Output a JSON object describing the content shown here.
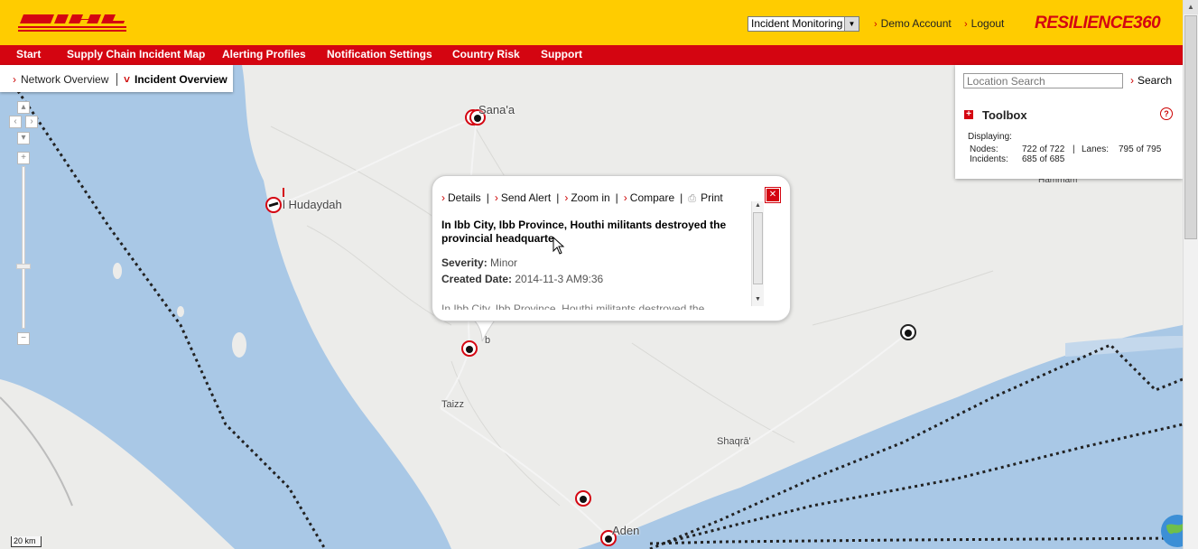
{
  "header": {
    "logo_text": "DHL",
    "mode_select": "Incident Monitoring",
    "account_link": "Demo Account",
    "logout_link": "Logout",
    "brand": "RESILIENCE360",
    "colors": {
      "brand_red": "#d40511",
      "brand_yellow": "#ffcc00"
    }
  },
  "nav": {
    "items": [
      "Start",
      "Supply Chain Incident Map",
      "Alerting Profiles",
      "Notification Settings",
      "Country Risk",
      "Support"
    ]
  },
  "view_tabs": {
    "network": "Network Overview",
    "incident": "Incident Overview"
  },
  "toolbox": {
    "search_placeholder": "Location Search",
    "search_label": "Search",
    "title": "Toolbox",
    "displaying_label": "Displaying:",
    "nodes_label": "Nodes:",
    "nodes_value": "722 of 722",
    "lanes_label": "Lanes:",
    "lanes_value": "795 of 795",
    "incidents_label": "Incidents:",
    "incidents_value": "685 of 685"
  },
  "popup": {
    "links": {
      "details": "Details",
      "send_alert": "Send Alert",
      "zoom_in": "Zoom in",
      "compare": "Compare",
      "print": "Print"
    },
    "title": "In Ibb City, Ibb Province, Houthi militants destroyed the provincial headquarte",
    "severity_label": "Severity:",
    "severity_value": "Minor",
    "created_label": "Created Date:",
    "created_value": "2014-11-3 AM9:36",
    "description_preview": "In Ibb City, Ibb Province, Houthi militants destroyed the"
  },
  "map": {
    "labels": {
      "sanaa": "Sana'a",
      "hudaydah": "l Hudaydah",
      "taizz": "Taizz",
      "shaqra": "Shaqrā'",
      "aden": "Aden",
      "hammam": "Hammam",
      "ibb": "b"
    },
    "scale": "20 km"
  }
}
